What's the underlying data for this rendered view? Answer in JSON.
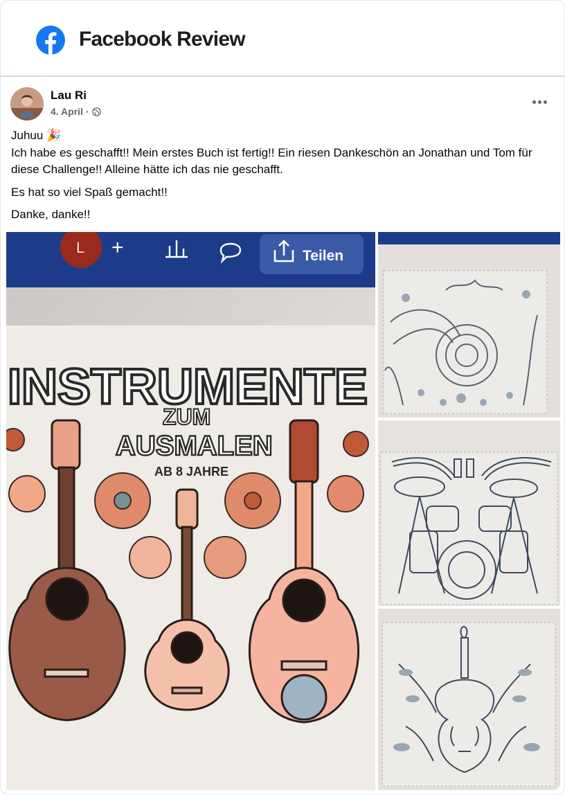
{
  "header": {
    "title": "Facebook Review",
    "brand_color": "#1877f2",
    "logo_icon": "facebook-logo-icon"
  },
  "post": {
    "author": "Lau Ri",
    "date": "4. April",
    "date_separator": "·",
    "audience_icon": "globe-icon",
    "menu_icon": "more-options-icon",
    "paragraphs": {
      "line1": "Juhuu 🎉",
      "line2": "Ich habe es geschafft!! Mein erstes Buch ist fertig!! Ein riesen Dankeschön an Jonathan und Tom für diese Challenge!! Alleine hätte ich das nie geschafft.",
      "line3": "Es hat so viel Spaß gemacht!!",
      "line4": "Danke, danke!!"
    }
  },
  "photos": {
    "main": {
      "toolbar_avatar_letter": "L",
      "toolbar_plus": "+",
      "share_label": "Teilen",
      "book_title_line1": "INSTRUMENTE",
      "book_title_line2": "ZUM",
      "book_title_line3": "AUSMALEN",
      "book_age": "AB 8 JAHRE"
    },
    "side": [
      "french-horn-coloring-page",
      "drum-kit-coloring-page",
      "violin-coloring-page"
    ]
  }
}
